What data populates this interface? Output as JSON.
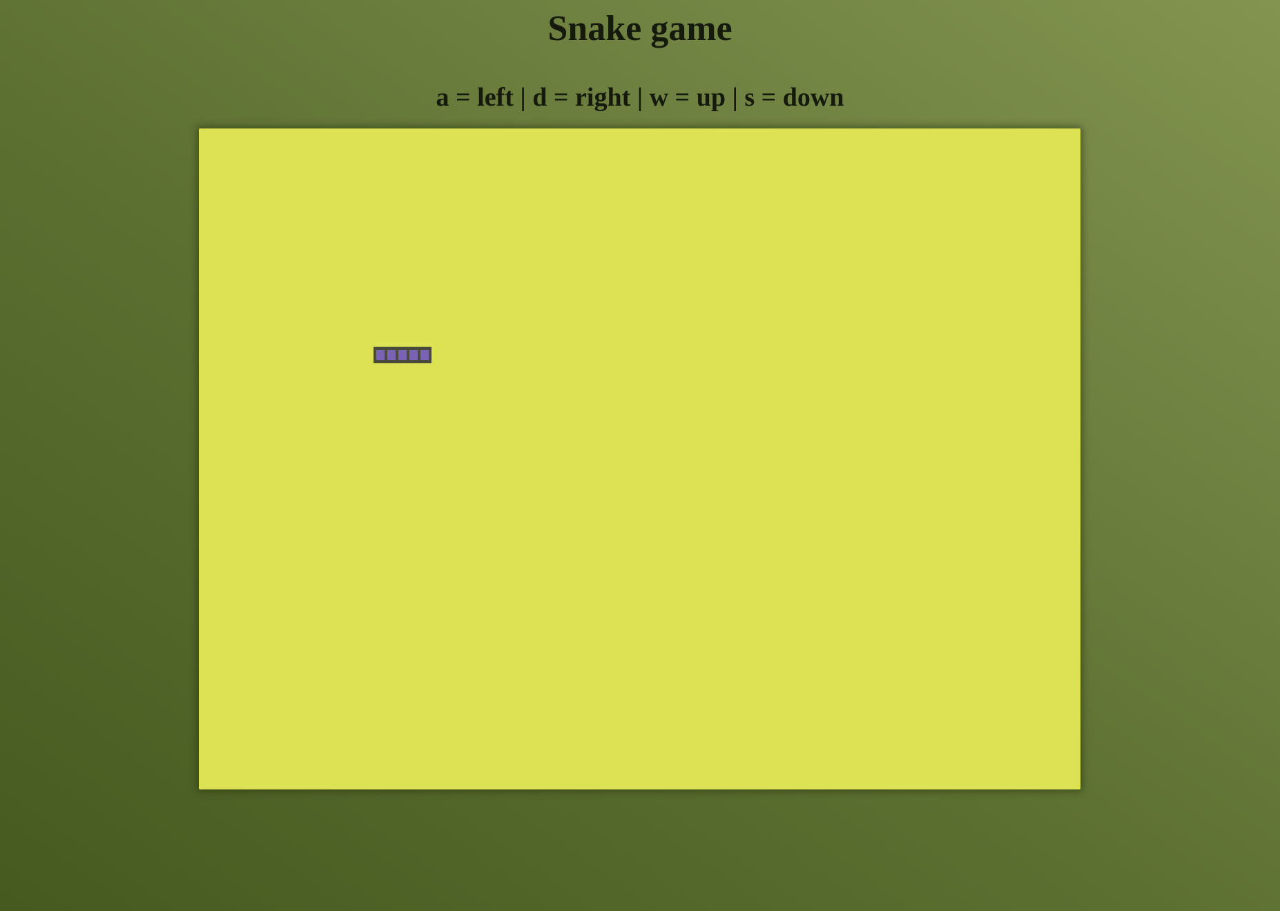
{
  "game": {
    "title": "Snake game",
    "controls_text": "a = left | d = right | w = up | s = down"
  },
  "colors": {
    "board": "#dce253",
    "snake_body": "#7b63b4",
    "snake_outline": "#4a4a3c"
  },
  "snake": {
    "segment_count": 5,
    "direction": "right"
  }
}
